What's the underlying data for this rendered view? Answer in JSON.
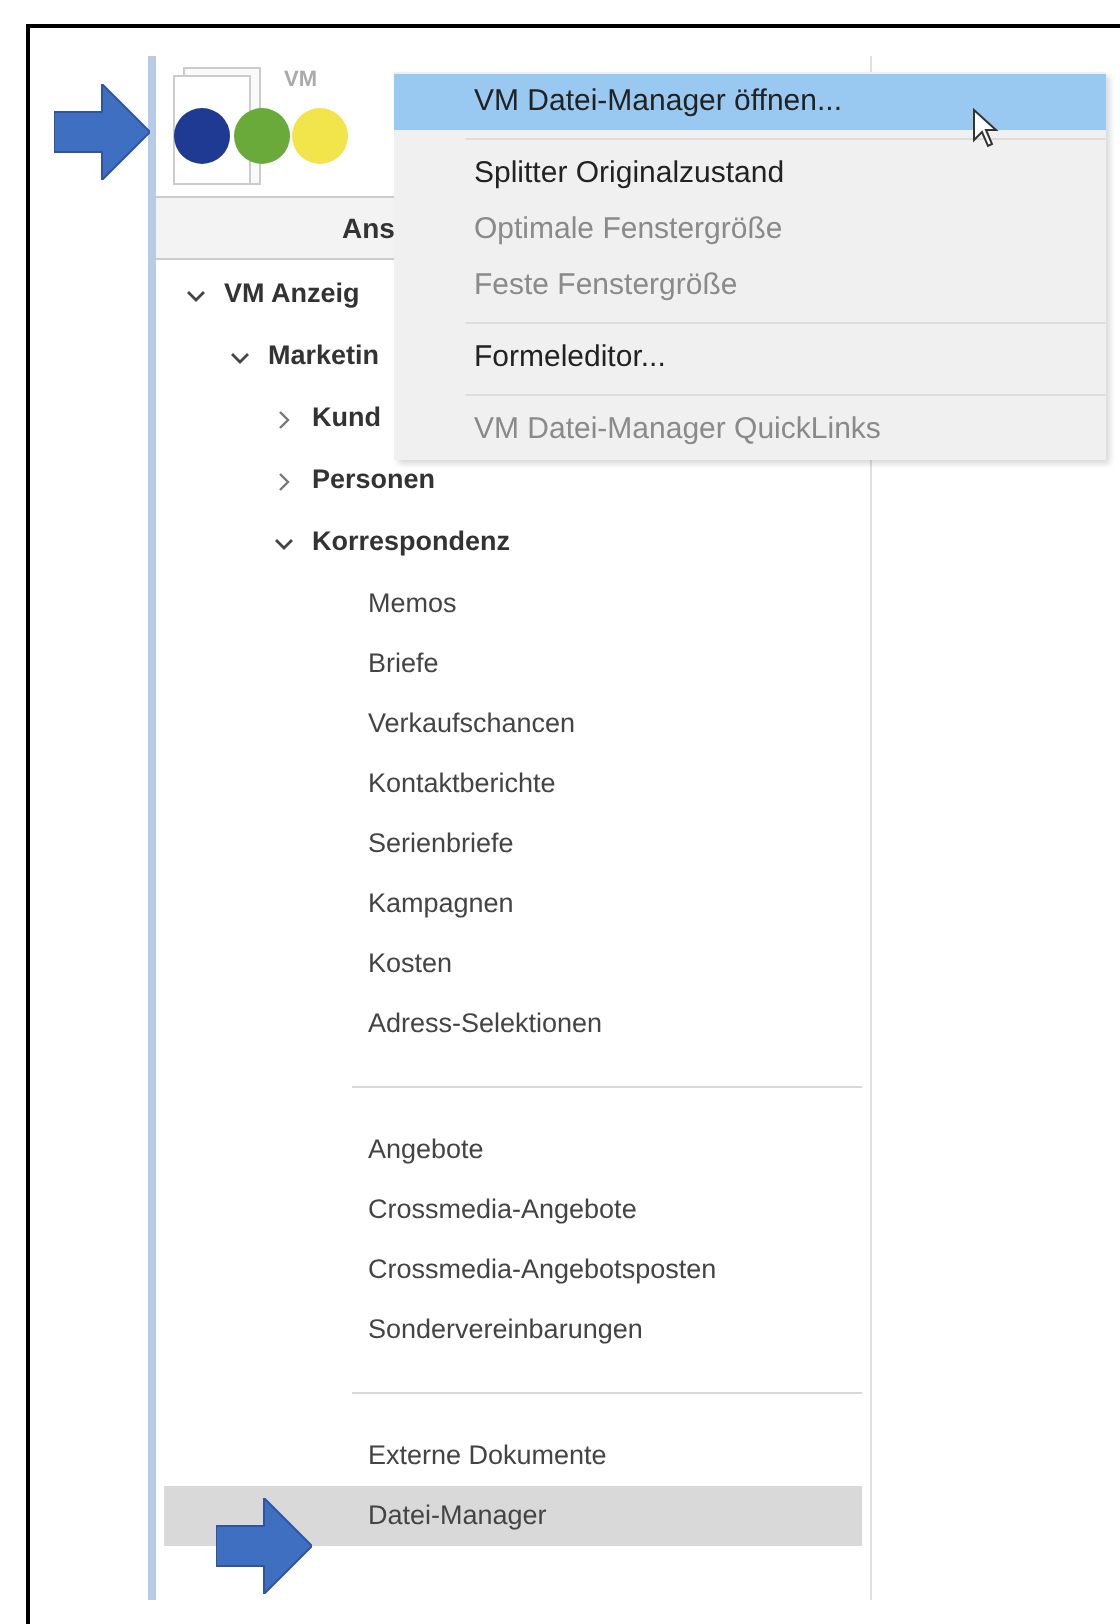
{
  "header": {
    "logo_text": "VM",
    "tab_label": "Ans"
  },
  "tree": [
    {
      "kind": "branch",
      "label": "VM Anzeig",
      "expanded": true,
      "children": [
        {
          "kind": "branch",
          "label": "Marketin",
          "expanded": true,
          "children": [
            {
              "kind": "branch",
              "label": "Kund",
              "expanded": false
            },
            {
              "kind": "branch",
              "label": "Personen",
              "expanded": false
            },
            {
              "kind": "branch",
              "label": "Korrespondenz",
              "expanded": true,
              "children": [
                {
                  "kind": "leaf",
                  "label": "Memos",
                  "selected": false
                },
                {
                  "kind": "leaf",
                  "label": "Briefe",
                  "selected": false
                },
                {
                  "kind": "leaf",
                  "label": "Verkaufschancen",
                  "selected": false
                },
                {
                  "kind": "leaf",
                  "label": "Kontaktberichte",
                  "selected": false
                },
                {
                  "kind": "leaf",
                  "label": "Serienbriefe",
                  "selected": false
                },
                {
                  "kind": "leaf",
                  "label": "Kampagnen",
                  "selected": false
                },
                {
                  "kind": "leaf",
                  "label": "Kosten",
                  "selected": false
                },
                {
                  "kind": "leaf",
                  "label": "Adress-Selektionen",
                  "selected": false
                },
                {
                  "kind": "separator"
                },
                {
                  "kind": "leaf",
                  "label": "Angebote",
                  "selected": false
                },
                {
                  "kind": "leaf",
                  "label": "Crossmedia-Angebote",
                  "selected": false
                },
                {
                  "kind": "leaf",
                  "label": "Crossmedia-Angebotsposten",
                  "selected": false
                },
                {
                  "kind": "leaf",
                  "label": "Sondervereinbarungen",
                  "selected": false
                },
                {
                  "kind": "separator"
                },
                {
                  "kind": "leaf",
                  "label": "Externe Dokumente",
                  "selected": false
                },
                {
                  "kind": "leaf",
                  "label": "Datei-Manager",
                  "selected": true
                }
              ]
            }
          ]
        }
      ]
    }
  ],
  "context_menu": [
    {
      "kind": "item",
      "label": "VM Datei-Manager öffnen...",
      "selected": true,
      "disabled": false
    },
    {
      "kind": "separator"
    },
    {
      "kind": "item",
      "label": "Splitter Originalzustand",
      "selected": false,
      "disabled": false
    },
    {
      "kind": "item",
      "label": "Optimale Fenstergröße",
      "selected": false,
      "disabled": true
    },
    {
      "kind": "item",
      "label": "Feste Fenstergröße",
      "selected": false,
      "disabled": true
    },
    {
      "kind": "separator"
    },
    {
      "kind": "item",
      "label": "Formeleditor...",
      "selected": false,
      "disabled": false
    },
    {
      "kind": "separator"
    },
    {
      "kind": "item",
      "label": "VM Datei-Manager QuickLinks",
      "selected": false,
      "disabled": true
    }
  ]
}
